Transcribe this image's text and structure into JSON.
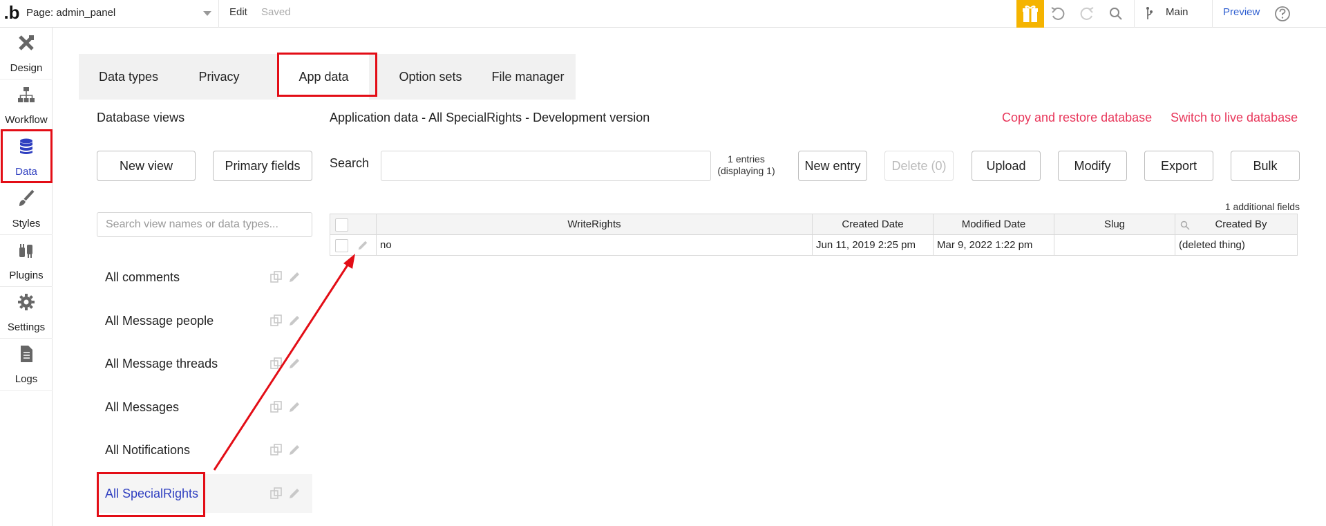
{
  "topbar": {
    "logo": ".b",
    "page_label": "Page: admin_panel",
    "edit_label": "Edit",
    "saved_label": "Saved",
    "branch_label": "Main",
    "preview_label": "Preview",
    "icons": [
      "gift-icon",
      "undo-icon",
      "redo-icon",
      "search-icon",
      "branch-icon",
      "help-icon"
    ],
    "gift_color": "#f5b400"
  },
  "sidebar": {
    "items": [
      {
        "label": "Design",
        "icon": "design-icon"
      },
      {
        "label": "Workflow",
        "icon": "workflow-icon"
      },
      {
        "label": "Data",
        "icon": "database-icon",
        "active": true
      },
      {
        "label": "Styles",
        "icon": "brush-icon"
      },
      {
        "label": "Plugins",
        "icon": "plug-icon"
      },
      {
        "label": "Settings",
        "icon": "gear-icon"
      },
      {
        "label": "Logs",
        "icon": "document-icon"
      }
    ]
  },
  "tabs": [
    {
      "label": "Data types"
    },
    {
      "label": "Privacy"
    },
    {
      "label": "App data",
      "active": true
    },
    {
      "label": "Option sets"
    },
    {
      "label": "File manager"
    }
  ],
  "views_panel": {
    "title": "Database views",
    "new_view_label": "New view",
    "primary_fields_label": "Primary fields",
    "search_placeholder": "Search view names or data types...",
    "items": [
      {
        "label": "All comments"
      },
      {
        "label": "All Message people"
      },
      {
        "label": "All Message threads"
      },
      {
        "label": "All Messages"
      },
      {
        "label": "All Notifications"
      },
      {
        "label": "All SpecialRights",
        "selected": true
      }
    ]
  },
  "main": {
    "title": "Application data - All SpecialRights - Development version",
    "copy_restore_label": "Copy and restore database",
    "switch_live_label": "Switch to live database",
    "search_label": "Search",
    "entries_line1": "1 entries",
    "entries_line2": "(displaying 1)",
    "new_entry_label": "New entry",
    "delete_label": "Delete (0)",
    "upload_label": "Upload",
    "modify_label": "Modify",
    "export_label": "Export",
    "bulk_label": "Bulk",
    "additional_fields": "1 additional fields",
    "link_color": "#e8365a"
  },
  "table": {
    "columns": [
      "WriteRights",
      "Created Date",
      "Modified Date",
      "Slug",
      "Created By"
    ],
    "rows": [
      {
        "WriteRights": "no",
        "Created Date": "Jun 11, 2019 2:25 pm",
        "Modified Date": "Mar 9, 2022 1:22 pm",
        "Slug": "",
        "Created By": "(deleted thing)"
      }
    ]
  },
  "annotation": {
    "highlight_color": "#e30d16"
  }
}
